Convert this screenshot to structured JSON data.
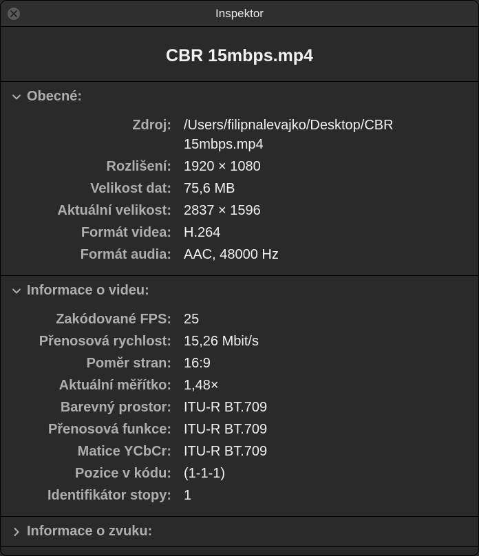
{
  "window": {
    "title": "Inspektor"
  },
  "file_title": "CBR 15mbps.mp4",
  "sections": {
    "general": {
      "title": "Obecné:",
      "expanded": true,
      "rows": [
        {
          "label": "Zdroj:",
          "value": "/Users/filipnalevajko/Desktop/CBR 15mbps.mp4"
        },
        {
          "label": "Rozlišení:",
          "value": "1920 × 1080"
        },
        {
          "label": "Velikost dat:",
          "value": "75,6 MB"
        },
        {
          "label": "Aktuální velikost:",
          "value": "2837 × 1596"
        },
        {
          "label": "Formát videa:",
          "value": "H.264"
        },
        {
          "label": "Formát audia:",
          "value": "AAC, 48000 Hz"
        }
      ]
    },
    "video": {
      "title": "Informace o videu:",
      "expanded": true,
      "rows": [
        {
          "label": "Zakódované FPS:",
          "value": "25"
        },
        {
          "label": "Přenosová rychlost:",
          "value": "15,26 Mbit/s"
        },
        {
          "label": "Poměr stran:",
          "value": "16:9"
        },
        {
          "label": "Aktuální měřítko:",
          "value": "1,48×"
        },
        {
          "label": "Barevný prostor:",
          "value": "ITU-R BT.709"
        },
        {
          "label": "Přenosová funkce:",
          "value": "ITU-R BT.709"
        },
        {
          "label": "Matice YCbCr:",
          "value": "ITU-R BT.709"
        },
        {
          "label": "Pozice v kódu:",
          "value": "(1-1-1)"
        },
        {
          "label": "Identifikátor stopy:",
          "value": "1"
        }
      ]
    },
    "audio": {
      "title": "Informace o zvuku:",
      "expanded": false
    }
  }
}
